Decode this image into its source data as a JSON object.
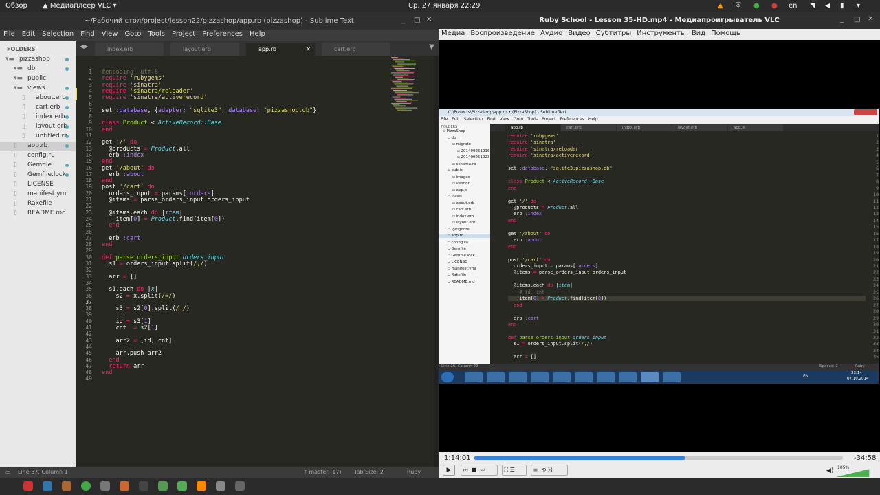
{
  "topbar": {
    "overview": "Обзор",
    "app": "Медиаплеер VLC",
    "clock": "Ср, 27 января 22:29",
    "lang": "en"
  },
  "sublime": {
    "title": "~/Рабочий стол/project/lesson22/pizzashop/app.rb (pizzashop) - Sublime Text",
    "menu": [
      "File",
      "Edit",
      "Selection",
      "Find",
      "View",
      "Goto",
      "Tools",
      "Project",
      "Preferences",
      "Help"
    ],
    "folders_label": "FOLDERS",
    "tree": [
      {
        "name": "pizzashop",
        "indent": 0,
        "type": "folder"
      },
      {
        "name": "db",
        "indent": 1,
        "type": "folder"
      },
      {
        "name": "public",
        "indent": 1,
        "type": "folder"
      },
      {
        "name": "views",
        "indent": 1,
        "type": "folder"
      },
      {
        "name": "about.erb",
        "indent": 2,
        "type": "file"
      },
      {
        "name": "cart.erb",
        "indent": 2,
        "type": "file"
      },
      {
        "name": "index.erb",
        "indent": 2,
        "type": "file"
      },
      {
        "name": "layout.erb",
        "indent": 2,
        "type": "file"
      },
      {
        "name": "untitled.ra",
        "indent": 2,
        "type": "file"
      },
      {
        "name": "app.rb",
        "indent": 1,
        "type": "file",
        "selected": true
      },
      {
        "name": "config.ru",
        "indent": 1,
        "type": "file"
      },
      {
        "name": "Gemfile",
        "indent": 1,
        "type": "file"
      },
      {
        "name": "Gemfile.lock",
        "indent": 1,
        "type": "file"
      },
      {
        "name": "LICENSE",
        "indent": 1,
        "type": "file"
      },
      {
        "name": "manifest.yml",
        "indent": 1,
        "type": "file"
      },
      {
        "name": "Rakefile",
        "indent": 1,
        "type": "file"
      },
      {
        "name": "README.md",
        "indent": 1,
        "type": "file"
      }
    ],
    "tabs": [
      {
        "label": "index.erb"
      },
      {
        "label": "layout.erb"
      },
      {
        "label": "app.rb",
        "active": true
      },
      {
        "label": "cart.erb"
      }
    ],
    "status": {
      "left": "Line 37, Column 1",
      "branch": "master",
      "changes": "17",
      "tab": "Tab Size: 2",
      "syntax": "Ruby"
    }
  },
  "vlc": {
    "title": "Ruby School - Lesson 35-HD.mp4 - Медиапроигрыватель VLC",
    "menu": [
      "Медиа",
      "Воспроизведение",
      "Аудио",
      "Видео",
      "Субтитры",
      "Инструменты",
      "Вид",
      "Помощь"
    ],
    "elapsed": "1:14:01",
    "remaining": "-34:58",
    "progress": 0.57,
    "volume": "105%",
    "inner": {
      "title": "C:\\Projects\\PizzaShop\\app.rb • (PizzaShop) - Sublime Text",
      "menu": [
        "File",
        "Edit",
        "Selection",
        "Find",
        "View",
        "Goto",
        "Tools",
        "Project",
        "Preferences",
        "Help"
      ],
      "folders_label": "FOLDERS",
      "tree": [
        "PizzaShop",
        "db",
        "migrate",
        "201409251916",
        "201409251923",
        "schema.rb",
        "public",
        "images",
        "vendor",
        "app.js",
        "views",
        "about.erb",
        "cart.erb",
        "index.erb",
        "layout.erb",
        ".gitignore",
        "app.rb",
        "config.ru",
        "Gemfile",
        "Gemfile.lock",
        "LICENSE",
        "manifest.yml",
        "Rakefile",
        "README.md"
      ],
      "tabs": [
        "app.rb",
        "cart.erb",
        "index.erb",
        "layout.erb",
        "app.js"
      ],
      "status_left": "Line 26, Column 22",
      "status_spaces": "Spaces: 2",
      "status_syntax": "Ruby",
      "tray_lang": "EN",
      "tray_time": "23:14",
      "tray_date": "07.10.2014"
    }
  }
}
